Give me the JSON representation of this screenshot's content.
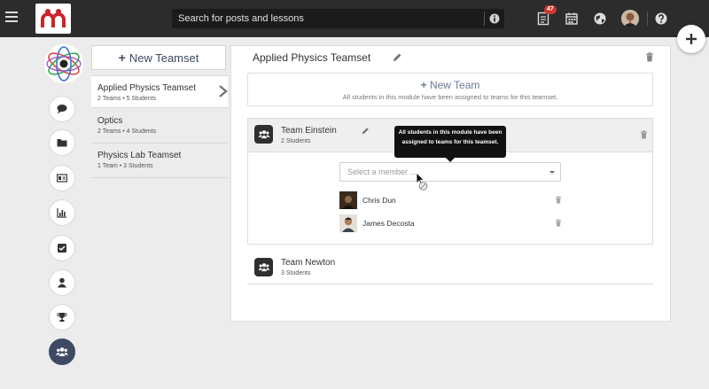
{
  "app": {
    "logo": "m-logo",
    "search": {
      "placeholder": "Search for posts and lessons"
    },
    "notifications_count": "47",
    "icons": [
      "menu-icon",
      "info-icon",
      "notes-icon",
      "calendar-icon",
      "globe-icon",
      "avatar",
      "help-icon",
      "plus-icon"
    ]
  },
  "rail": {
    "items": [
      "chat-icon",
      "folder-icon",
      "id-card-icon",
      "bar-chart-icon",
      "checkbox-icon",
      "person-icon",
      "trophy-icon",
      "group-icon"
    ]
  },
  "teamsets": {
    "new_label": "New Teamset",
    "items": [
      {
        "name": "Applied Physics Teamset",
        "meta": "2 Teams • 5 Students"
      },
      {
        "name": "Optics",
        "meta": "2 Teams • 4 Students"
      },
      {
        "name": "Physics Lab Teamset",
        "meta": "1 Team • 3 Students"
      }
    ]
  },
  "main": {
    "title": "Applied Physics Teamset",
    "new_team_label": "New Team",
    "new_team_sub": "All students in this module have been assigned to teams for this teamset.",
    "teams": [
      {
        "name": "Team Einstein",
        "count": "2 Students"
      },
      {
        "name": "Team Newton",
        "count": "3 Students"
      }
    ],
    "select_placeholder": "Select a member ...",
    "members": [
      {
        "name": "Chris Dun"
      },
      {
        "name": "James Decosta"
      }
    ],
    "tooltip": "All students in this module have been assigned to teams for this teamset."
  },
  "colors": {
    "topbar": "#2c2c2c",
    "accent": "#3d4a62",
    "badge": "#d0342c",
    "brand_red": "#c8262e"
  }
}
